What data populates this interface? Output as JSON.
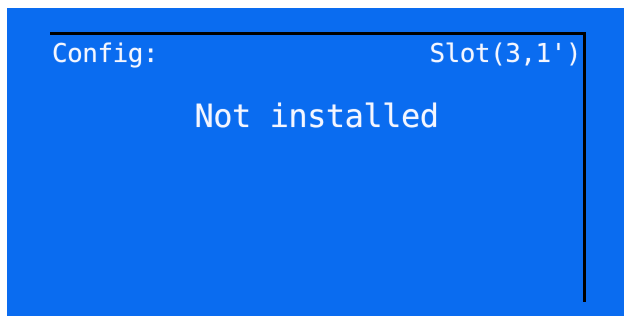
{
  "display": {
    "config_label": "Config:",
    "slot_label": "Slot(3,1')",
    "message": "Not installed"
  },
  "colors": {
    "frame_background": "#0a6cf0",
    "screen_background": "#0a6cf0",
    "text": "#f4f6ff",
    "border": "#000000"
  }
}
